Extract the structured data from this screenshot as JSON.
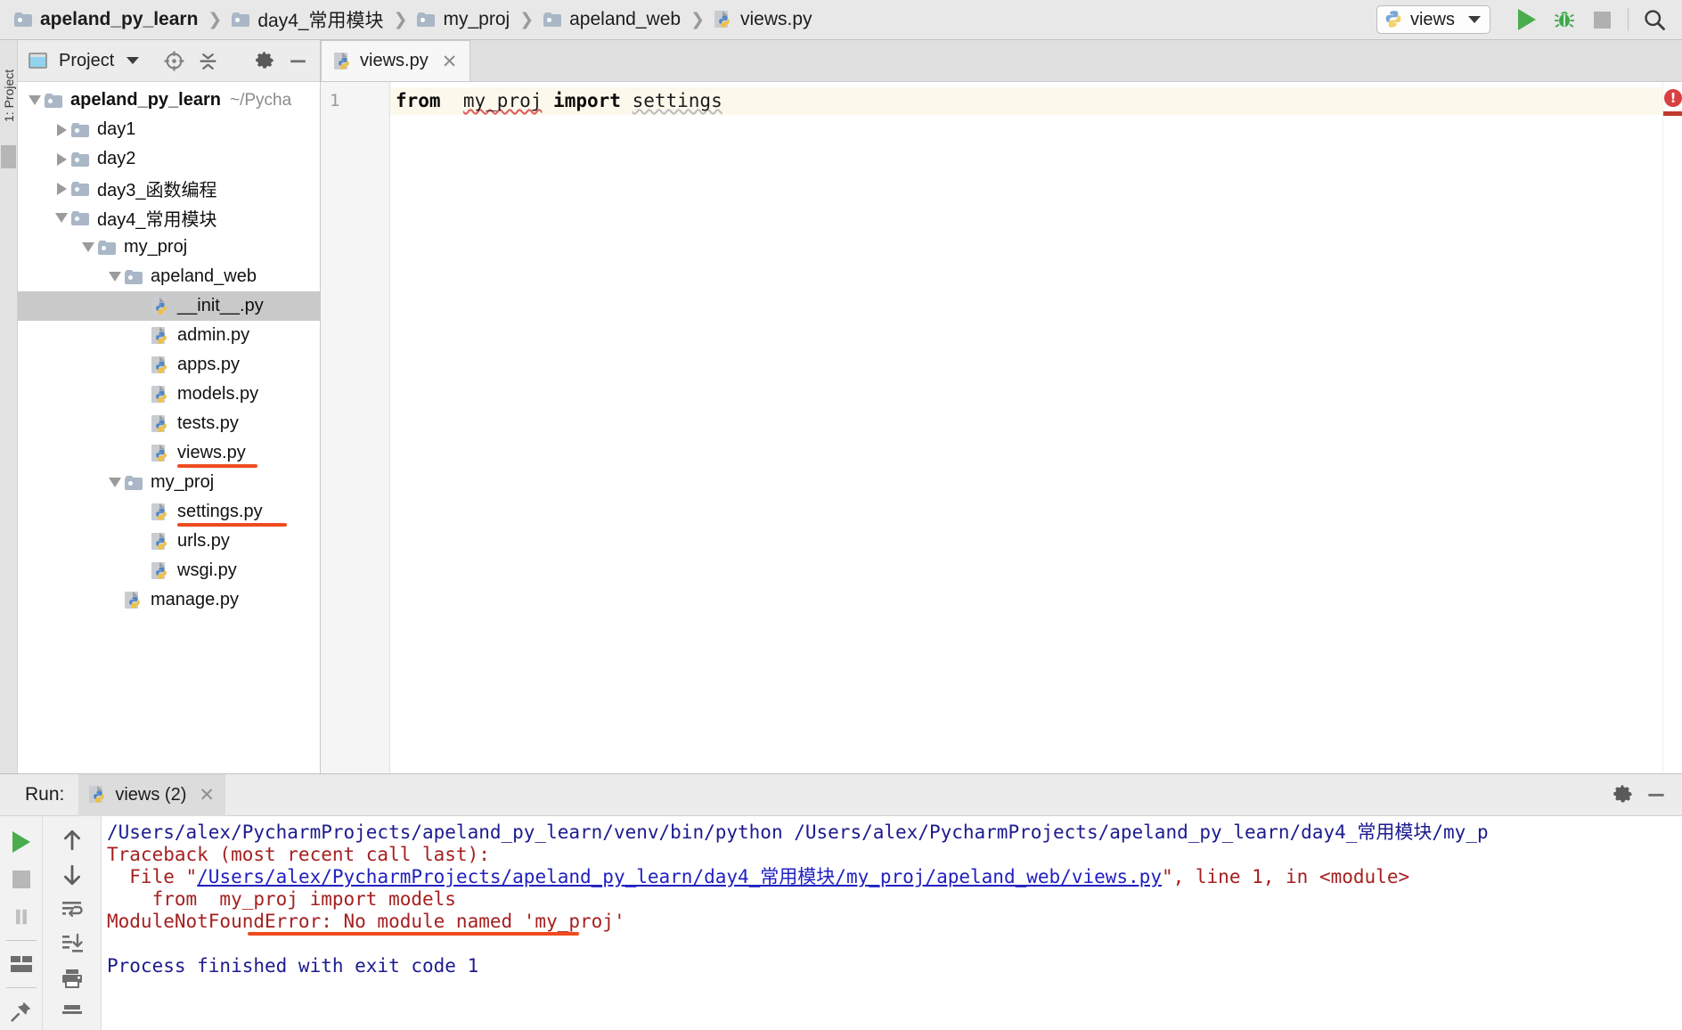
{
  "breadcrumb": [
    {
      "label": "apeland_py_learn",
      "icon": "folder-icon",
      "root": true
    },
    {
      "label": "day4_常用模块",
      "icon": "folder-icon"
    },
    {
      "label": "my_proj",
      "icon": "folder-icon"
    },
    {
      "label": "apeland_web",
      "icon": "folder-icon"
    },
    {
      "label": "views.py",
      "icon": "python-file-icon"
    }
  ],
  "breadcrumb_separator": "❯",
  "toolbar": {
    "run_config_name": "views",
    "run_label": "Run",
    "debug_label": "Debug",
    "stop_label": "Stop",
    "search_label": "Search Everywhere"
  },
  "left_strip": {
    "label": "1: Project"
  },
  "project_panel": {
    "title": "Project",
    "buttons": [
      "select-opened-file",
      "collapse-all",
      "settings",
      "hide"
    ],
    "tree": [
      {
        "label": "apeland_py_learn",
        "suffix": "~/Pycha",
        "depth": 0,
        "type": "folder",
        "state": "expanded",
        "bold": true
      },
      {
        "label": "day1",
        "depth": 1,
        "type": "folder",
        "state": "collapsed"
      },
      {
        "label": "day2",
        "depth": 1,
        "type": "folder",
        "state": "collapsed"
      },
      {
        "label": "day3_函数编程",
        "depth": 1,
        "type": "folder",
        "state": "collapsed"
      },
      {
        "label": "day4_常用模块",
        "depth": 1,
        "type": "folder",
        "state": "expanded"
      },
      {
        "label": "my_proj",
        "depth": 2,
        "type": "folder",
        "state": "expanded"
      },
      {
        "label": "apeland_web",
        "depth": 3,
        "type": "folder",
        "state": "expanded"
      },
      {
        "label": "__init__.py",
        "depth": 4,
        "type": "python",
        "selected": true
      },
      {
        "label": "admin.py",
        "depth": 4,
        "type": "python"
      },
      {
        "label": "apps.py",
        "depth": 4,
        "type": "python"
      },
      {
        "label": "models.py",
        "depth": 4,
        "type": "python"
      },
      {
        "label": "tests.py",
        "depth": 4,
        "type": "python"
      },
      {
        "label": "views.py",
        "depth": 4,
        "type": "python",
        "annotated": true
      },
      {
        "label": "my_proj",
        "depth": 3,
        "type": "folder",
        "state": "expanded"
      },
      {
        "label": "settings.py",
        "depth": 4,
        "type": "python",
        "annotated": true
      },
      {
        "label": "urls.py",
        "depth": 4,
        "type": "python"
      },
      {
        "label": "wsgi.py",
        "depth": 4,
        "type": "python"
      },
      {
        "label": "manage.py",
        "depth": 3,
        "type": "python"
      }
    ]
  },
  "editor": {
    "tab_label": "views.py",
    "tab_close": "✕",
    "line_numbers": [
      "1"
    ],
    "code_tokens": [
      {
        "text": "from",
        "style": "keyword"
      },
      {
        "text": "  ",
        "style": "plain"
      },
      {
        "text": "my_proj",
        "style": "squiggle-red"
      },
      {
        "text": " ",
        "style": "plain"
      },
      {
        "text": "import",
        "style": "keyword"
      },
      {
        "text": " ",
        "style": "plain"
      },
      {
        "text": "settings",
        "style": "squiggle-gray"
      }
    ],
    "code_plain": "from  my_proj import settings",
    "error_badge": "!"
  },
  "run_panel": {
    "run_label": "Run:",
    "tab_label": "views (2)",
    "tab_close": "✕",
    "header_buttons": [
      "settings-gear",
      "minimize"
    ],
    "left_tools": [
      "rerun-icon",
      "stop-icon",
      "pause-icon",
      "layout-icon",
      "pin-icon"
    ],
    "right_tools": [
      "up-arrow-icon",
      "down-arrow-icon",
      "soft-wrap-icon",
      "scroll-to-end-icon",
      "print-icon",
      "clear-all-icon"
    ],
    "console_lines": [
      {
        "color": "blue",
        "text": "/Users/alex/PycharmProjects/apeland_py_learn/venv/bin/python /Users/alex/PycharmProjects/apeland_py_learn/day4_常用模块/my_p"
      },
      {
        "color": "red",
        "text": "Traceback (most recent call last):"
      },
      {
        "color": "red",
        "text": "  File \"",
        "link": "/Users/alex/PycharmProjects/apeland_py_learn/day4_常用模块/my_proj/apeland_web/views.py",
        "tail": "\", line 1, in <module>"
      },
      {
        "color": "red",
        "text": "    from  my_proj import models"
      },
      {
        "color": "red",
        "text": "ModuleNotFoundError: No module named 'my_proj'",
        "annotated": true
      },
      {
        "color": "blue",
        "text": ""
      },
      {
        "color": "blue",
        "text": "Process finished with exit code 1"
      }
    ]
  },
  "colors": {
    "annotation_red": "#ef4b1e",
    "error_red": "#a52020",
    "console_blue": "#1b1b8f",
    "link_blue": "#2020c0",
    "run_green": "#49ad4d",
    "selection_gray": "#c9c9c9"
  }
}
